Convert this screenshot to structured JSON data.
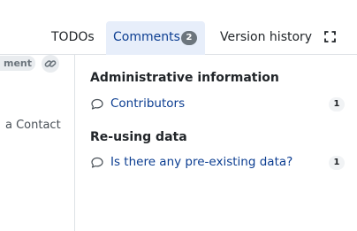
{
  "tabs": {
    "todos": "TODOs",
    "comments": "Comments",
    "comments_count": "2",
    "version_history": "Version history"
  },
  "left_panel": {
    "badge_text": "ment",
    "contact_text": "a Contact"
  },
  "sections": [
    {
      "title": "Administrative information",
      "items": [
        {
          "label": "Contributors",
          "count": "1"
        }
      ]
    },
    {
      "title": "Re-using data",
      "items": [
        {
          "label": "Is there any pre-existing data?",
          "count": "1"
        }
      ]
    }
  ],
  "colors": {
    "active_tab_bg": "#e7eefa",
    "link": "#0b3d91",
    "badge_bg": "#6c757d"
  }
}
